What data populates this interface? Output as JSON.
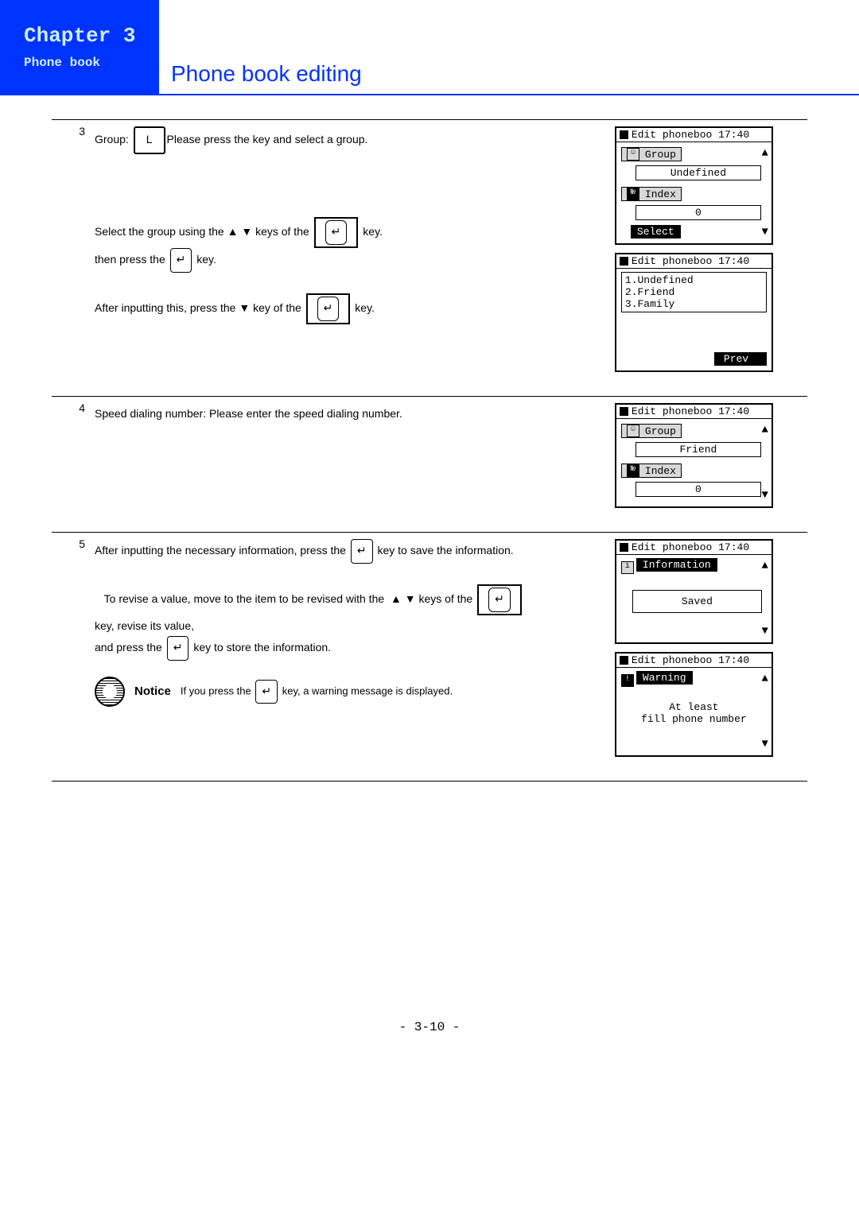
{
  "header": {
    "chapter_label": "Chapter 3",
    "chapter_sub": "Phone book",
    "page_title": "Phone book editing"
  },
  "steps": {
    "s3": {
      "num": "3",
      "line1a": "Group:",
      "key_L": "L",
      "line1b": "Please press the   key and select a group.",
      "line2a": "Select the group using the",
      "line2b": "keys of the",
      "line2c": "key.",
      "line3a": "then press the",
      "line3b": "key.",
      "line4a": "After inputting this, press the",
      "line4b": "key of the",
      "line4c": "key."
    },
    "s4": {
      "num": "4",
      "text": "Speed dialing number:  Please enter the speed dialing number."
    },
    "s5": {
      "num": "5",
      "line1a": "After inputting the necessary information,  press the",
      "line1b": "key to save the information.",
      "line2a": "To revise a value, move to the item to be revised with the",
      "line2b": "keys of the",
      "line3": "key, revise its value,",
      "line4a": "and press the",
      "line4b": "key to store the information.",
      "notice_label": "Notice",
      "notice_a": "If you press the",
      "notice_b": "key, a warning message is displayed."
    }
  },
  "screens": {
    "a": {
      "title": "Edit phoneboo 17:40",
      "group_lbl": "Group",
      "group_val": "Undefined",
      "index_lbl": "Index",
      "index_val": "0",
      "select": "Select"
    },
    "b": {
      "title": "Edit phoneboo 17:40",
      "item1": "1.Undefined",
      "item2": "2.Friend",
      "item3": "3.Family",
      "prev": "Prev"
    },
    "c": {
      "title": "Edit phoneboo 17:40",
      "group_lbl": "Group",
      "group_val": "Friend",
      "index_lbl": "Index",
      "index_val": "0"
    },
    "d": {
      "title": "Edit phoneboo 17:40",
      "bar": "Information",
      "msg": "Saved"
    },
    "e": {
      "title": "Edit phoneboo 17:40",
      "bar": "Warning",
      "msg1": "At least",
      "msg2": "fill phone number"
    }
  },
  "footer": "- 3-10 -"
}
